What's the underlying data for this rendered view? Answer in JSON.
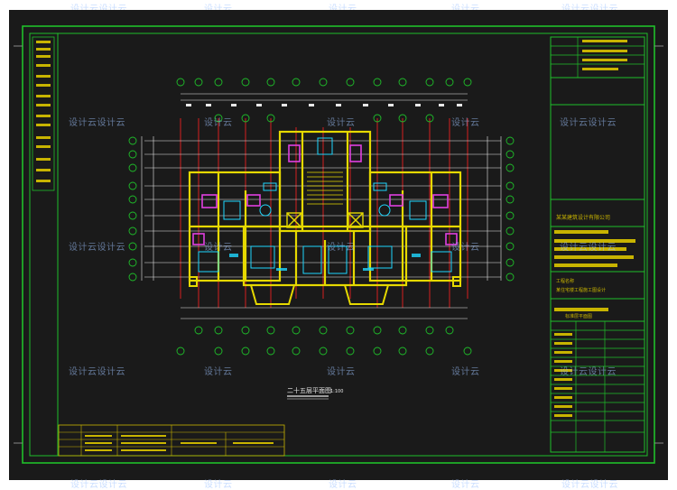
{
  "drawing": {
    "plan_title": "二十五层平面图",
    "scale": "1:100"
  },
  "title_block": {
    "company": "某某建筑设计有限公司",
    "project_label": "工程名称",
    "project_name": "某住宅楼工程施工图设计",
    "sheet_title": "标准层平面图"
  },
  "watermark": {
    "text": "设计云设计云",
    "text_short": "设计云"
  },
  "colors": {
    "background": "#1a1a1a",
    "border": "#1fbf2a",
    "walls": "#e6d900",
    "axis": "#d42020",
    "dim": "#e8e8e8",
    "furniture": "#1fd7ff"
  }
}
